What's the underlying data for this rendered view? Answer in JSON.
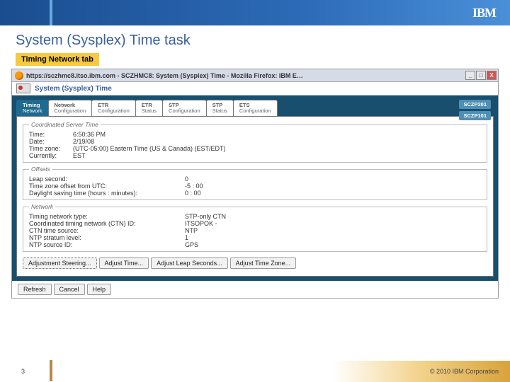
{
  "header": {
    "logo": "IBM",
    "title": "System (Sysplex) Time task",
    "subtitle": "Timing Network tab"
  },
  "browser": {
    "title": "https://sczhmc8.itso.ibm.com - SCZHMC8: System (Sysplex) Time - Mozilla Firefox: IBM E…",
    "min": "_",
    "max": "□",
    "close": "X"
  },
  "sysplex": {
    "heading": "System (Sysplex) Time"
  },
  "tabs": [
    {
      "l1": "Timing",
      "l2": "Network"
    },
    {
      "l1": "Network",
      "l2": "Configuration"
    },
    {
      "l1": "ETR",
      "l2": "Configuration"
    },
    {
      "l1": "ETR",
      "l2": "Status"
    },
    {
      "l1": "STP",
      "l2": "Configuration"
    },
    {
      "l1": "STP",
      "l2": "Status"
    },
    {
      "l1": "ETS",
      "l2": "Configuration"
    }
  ],
  "side_labels": [
    "SCZP201",
    "SCZP101"
  ],
  "sections": {
    "server_time": {
      "legend": "Coordinated Server Time",
      "rows": [
        {
          "k": "Time:",
          "v": "6:50:36 PM"
        },
        {
          "k": "Date:",
          "v": "2/19/08"
        },
        {
          "k": "Time zone:",
          "v": "(UTC-05:00) Eastern Time (US & Canada) (EST/EDT)"
        },
        {
          "k": "Currently:",
          "v": "EST"
        }
      ]
    },
    "offsets": {
      "legend": "Offsets",
      "rows": [
        {
          "k": "Leap second:",
          "v": "0"
        },
        {
          "k": "Time zone offset from UTC:",
          "v": "-5 : 00"
        },
        {
          "k": "Daylight saving time (hours : minutes):",
          "v": "0 : 00"
        }
      ]
    },
    "network": {
      "legend": "Network",
      "rows": [
        {
          "k": "Timing network type:",
          "v": "STP-only CTN"
        },
        {
          "k": "Coordinated timing network (CTN) ID:",
          "v": "ITSOPOK -"
        },
        {
          "k": "CTN time source:",
          "v": "NTP"
        },
        {
          "k": "NTP stratum level:",
          "v": "1"
        },
        {
          "k": "NTP source ID:",
          "v": "GPS"
        }
      ]
    }
  },
  "action_buttons": [
    "Adjustment Steering...",
    "Adjust Time...",
    "Adjust Leap Seconds...",
    "Adjust Time Zone..."
  ],
  "bottom_buttons": [
    "Refresh",
    "Cancel",
    "Help"
  ],
  "footer": {
    "page": "3",
    "copyright": "© 2010 IBM Corporation"
  }
}
